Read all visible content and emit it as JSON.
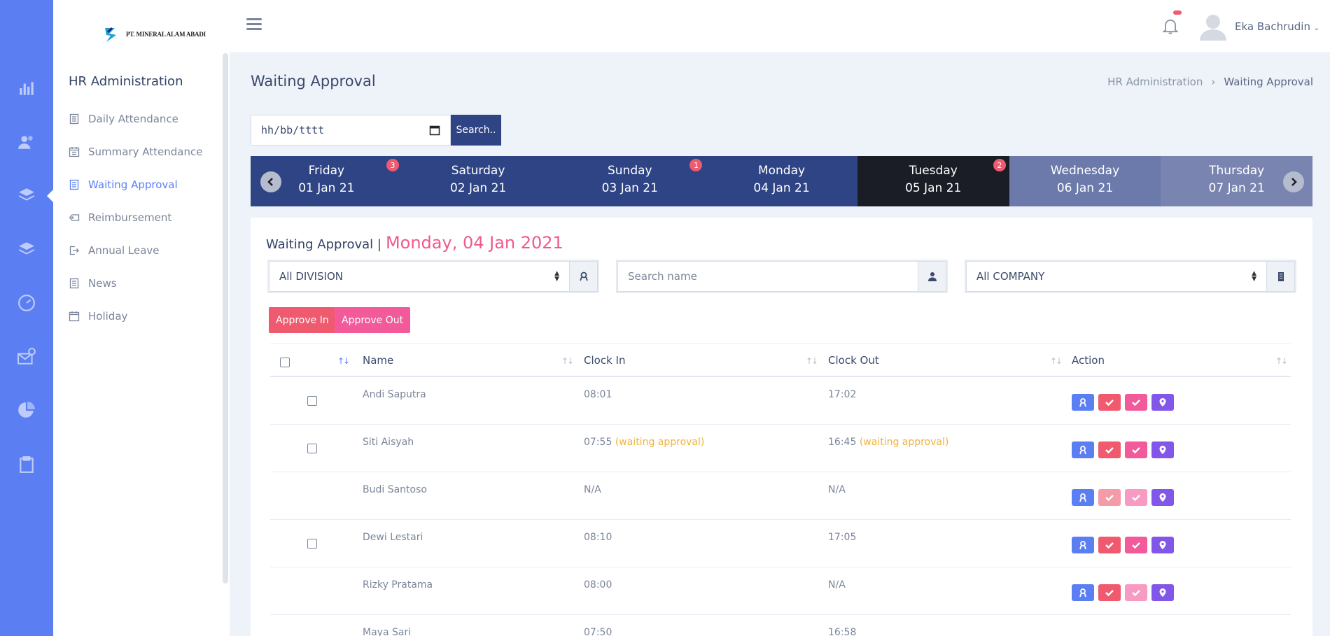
{
  "brand": {
    "company_name": "PT. MINERAL ALAM ABADI"
  },
  "subnav": {
    "title": "HR Administration",
    "items": [
      {
        "label": "Daily Attendance",
        "icon": "document-icon"
      },
      {
        "label": "Summary Attendance",
        "icon": "calendar-list-icon"
      },
      {
        "label": "Waiting Approval",
        "icon": "document-icon",
        "active": true
      },
      {
        "label": "Reimbursement",
        "icon": "tag-icon"
      },
      {
        "label": "Annual Leave",
        "icon": "exit-icon"
      },
      {
        "label": "News",
        "icon": "document-icon"
      },
      {
        "label": "Holiday",
        "icon": "calendar-icon"
      }
    ]
  },
  "rail": {
    "icons": [
      "bar-chart-icon",
      "users-icon",
      "layers-icon",
      "layers-icon",
      "dashboard-icon",
      "mail-chat-icon",
      "pie-chart-icon",
      "clipboard-icon"
    ]
  },
  "topbar": {
    "user_name": "Eka Bachrudin"
  },
  "header": {
    "title": "Waiting Approval",
    "breadcrumb": [
      "HR Administration",
      "Waiting Approval"
    ]
  },
  "date_search": {
    "placeholder": "hh/bb/tttt",
    "button": "Search.."
  },
  "days": [
    {
      "name": "Friday",
      "date": "01 Jan 21",
      "badge": "3"
    },
    {
      "name": "Saturday",
      "date": "02 Jan 21",
      "badge": ""
    },
    {
      "name": "Sunday",
      "date": "03 Jan 21",
      "badge": "1"
    },
    {
      "name": "Monday",
      "date": "04 Jan 21",
      "badge": ""
    },
    {
      "name": "Tuesday",
      "date": "05 Jan 21",
      "badge": "2",
      "state": "active"
    },
    {
      "name": "Wednesday",
      "date": "06 Jan 21",
      "badge": "",
      "state": "future"
    },
    {
      "name": "Thursday",
      "date": "07 Jan 21",
      "badge": "",
      "state": "future"
    }
  ],
  "card": {
    "heading": "Waiting Approval |",
    "date": "Monday, 04 Jan 2021"
  },
  "filters": {
    "division": "All DIVISION",
    "name_placeholder": "Search name",
    "company": "All COMPANY"
  },
  "buttons": {
    "approve_in": "Approve In",
    "approve_out": "Approve Out"
  },
  "table": {
    "columns": [
      "Name",
      "Clock In",
      "Clock Out",
      "Action"
    ],
    "rows": [
      {
        "name": "Andi Saputra",
        "clock_in": "08:01",
        "clock_in_note": "",
        "clock_out": "17:02",
        "clock_out_note": "",
        "checkbox": true,
        "in_enabled": true,
        "out_enabled": true
      },
      {
        "name": "Siti Aisyah",
        "clock_in": "07:55",
        "clock_in_note": "(waiting approval)",
        "clock_out": "16:45",
        "clock_out_note": "(waiting approval)",
        "checkbox": true,
        "in_enabled": true,
        "out_enabled": true
      },
      {
        "name": "Budi Santoso",
        "clock_in": "N/A",
        "clock_in_note": "",
        "clock_out": "N/A",
        "clock_out_note": "",
        "checkbox": false,
        "in_enabled": false,
        "out_enabled": false
      },
      {
        "name": "Dewi Lestari",
        "clock_in": "08:10",
        "clock_in_note": "",
        "clock_out": "17:05",
        "clock_out_note": "",
        "checkbox": true,
        "in_enabled": true,
        "out_enabled": true
      },
      {
        "name": "Rizky Pratama",
        "clock_in": "08:00",
        "clock_in_note": "",
        "clock_out": "N/A",
        "clock_out_note": "",
        "checkbox": false,
        "in_enabled": true,
        "out_enabled": false
      },
      {
        "name": "Maya Sari",
        "clock_in": "07:50",
        "clock_in_note": "",
        "clock_out": "16:58",
        "clock_out_note": "",
        "checkbox": false,
        "in_enabled": true,
        "out_enabled": true
      }
    ]
  },
  "colors": {
    "rail": "#5b7ff3",
    "day_strip": "#2e4484",
    "day_active": "#1a1d26",
    "accent_pink": "#ef5a89",
    "waiting": "#f0b33a"
  }
}
